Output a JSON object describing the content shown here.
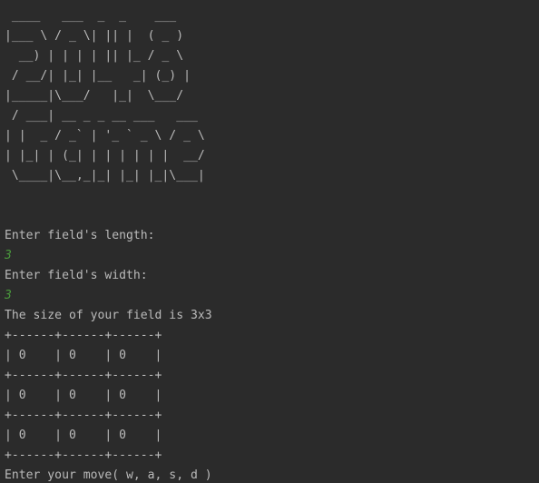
{
  "banner_lines": [
    " ____   ___  _  _    ___  ",
    "|___ \\ / _ \\| || |  ( _ ) ",
    "  __) | | | | || |_ / _ \\ ",
    " / __/| |_| |__   _| (_) |",
    "|_____|\\___/   |_|  \\___/ ",
    " / ___| __ _ _ __ ___   ___ ",
    "| |  _ / _` | '_ ` _ \\ / _ \\",
    "| |_| | (_| | | | | | |  __/",
    " \\____|\\__,_|_| |_| |_|\\___|"
  ],
  "prompts": {
    "length_prompt": "Enter field's length:",
    "length_value": "3",
    "width_prompt": "Enter field's width:",
    "width_value": "3",
    "size_message": "The size of your field is 3x3",
    "move_prompt": "Enter your move( w, a, s, d )"
  },
  "board": {
    "border": "+------+------+------+",
    "rows": [
      "| 0    | 0    | 0    |",
      "| 0    | 0    | 0    |",
      "| 0    | 0    | 0    |"
    ]
  },
  "colors": {
    "background": "#2b2b2b",
    "text": "#bbbbbb",
    "user_input": "#4a9a3c"
  }
}
